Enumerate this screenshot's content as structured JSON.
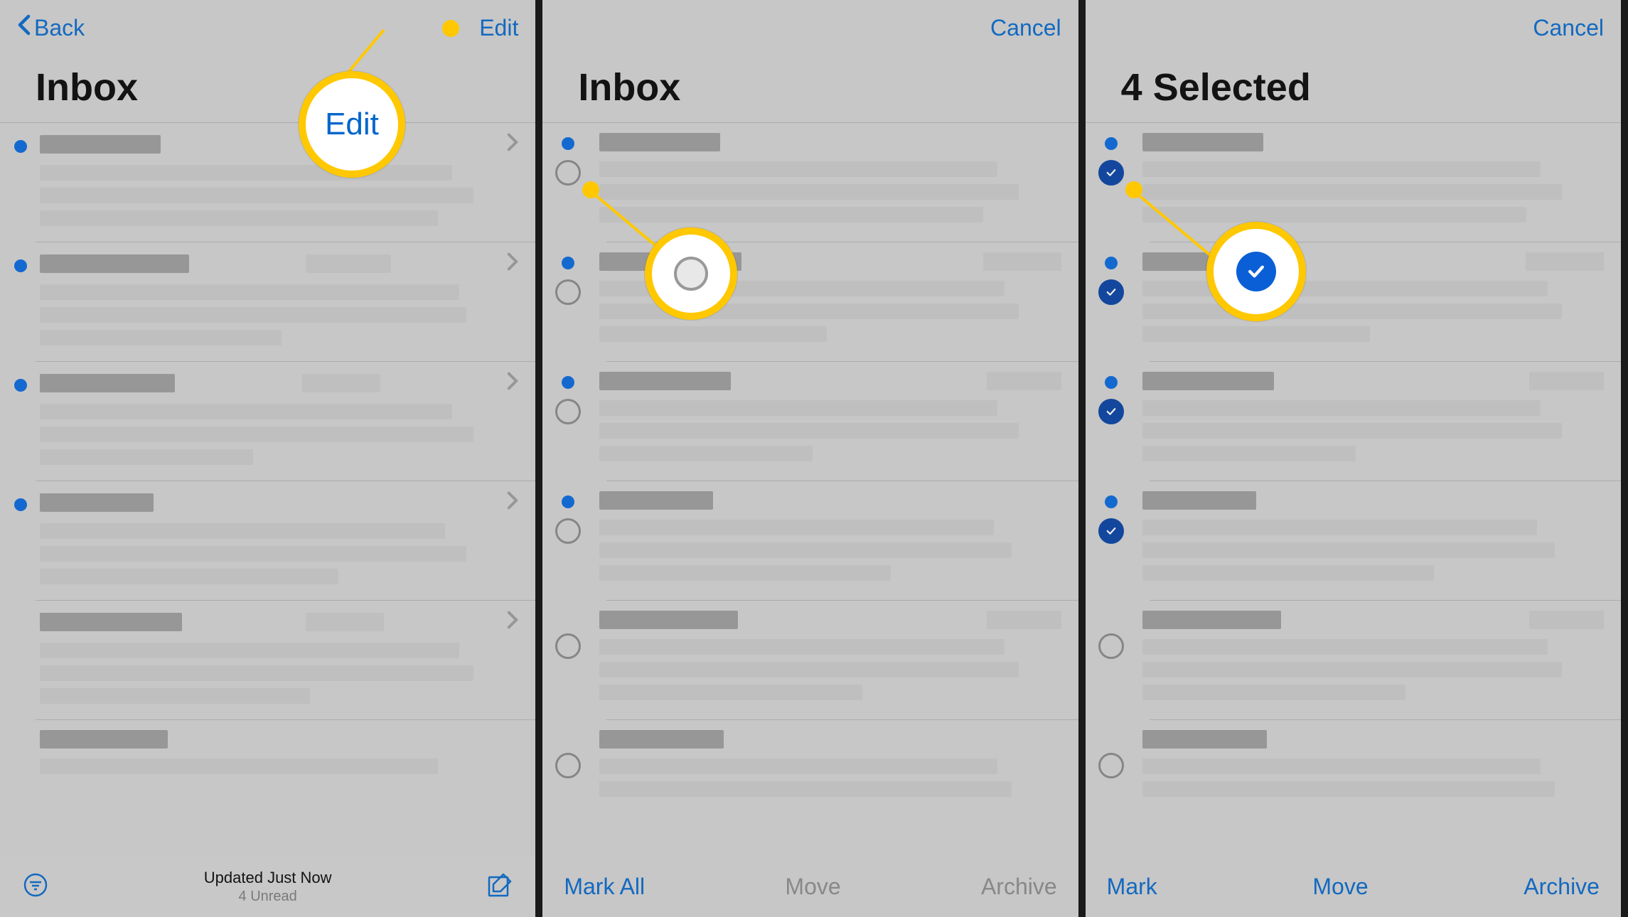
{
  "panel1": {
    "back_label": "Back",
    "edit_label": "Edit",
    "title": "Inbox",
    "status": "Updated Just Now",
    "sub_status": "4 Unread",
    "callout_label": "Edit"
  },
  "panel2": {
    "cancel_label": "Cancel",
    "title": "Inbox",
    "mark_all": "Mark All",
    "move": "Move",
    "archive": "Archive"
  },
  "panel3": {
    "cancel_label": "Cancel",
    "title": "4 Selected",
    "mark": "Mark",
    "move": "Move",
    "archive": "Archive"
  },
  "icons": {
    "back": "chevron-back-icon",
    "filter": "filter-icon",
    "compose": "compose-icon",
    "disclosure": "chevron-right-icon",
    "check": "checkmark-icon"
  }
}
